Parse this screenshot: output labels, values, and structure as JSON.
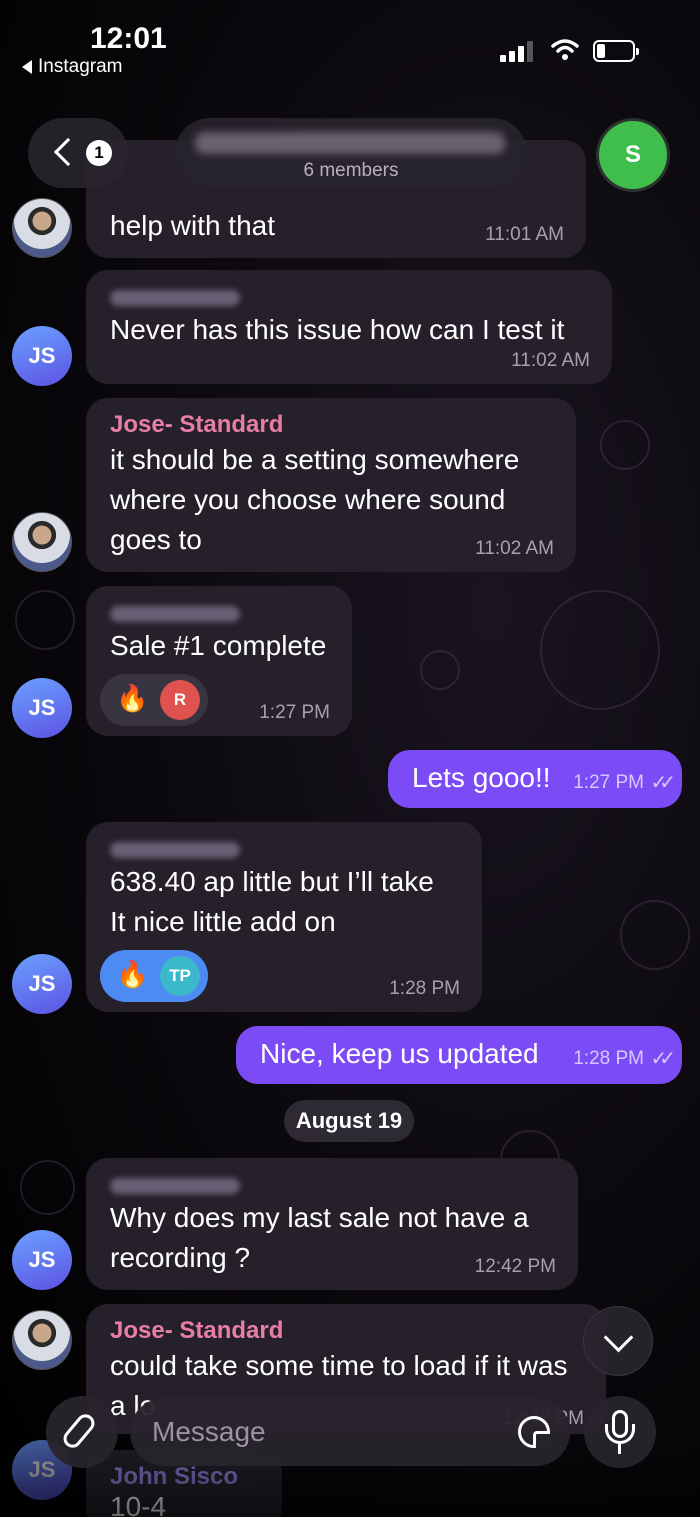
{
  "status_bar": {
    "time": "12:01",
    "back_app": "Instagram"
  },
  "header": {
    "unread_count": "1",
    "members": "6 members",
    "avatar_letter": "S",
    "avatar_color": "#3fbe4c"
  },
  "messages": [
    {
      "text": "help with that",
      "time": "11:01 AM"
    },
    {
      "text": "Never has this issue how can I test it",
      "time": "11:02 AM",
      "avatar": "JS"
    },
    {
      "sender": "Jose- Standard",
      "text": "it should be a setting somewhere\nwhere you choose where sound\ngoes to",
      "time": "11:02 AM"
    },
    {
      "text": "Sale #1 complete",
      "time": "1:27 PM",
      "avatar": "JS",
      "reaction_emoji": "🔥",
      "reaction_user": "R"
    },
    {
      "text": "Lets gooo!!",
      "time": "1:27 PM",
      "outgoing": true
    },
    {
      "text": "638.40 ap little but I’ll take\nIt nice little add on",
      "time": "1:28 PM",
      "avatar": "JS",
      "reaction_emoji": "🔥",
      "reaction_user": "TP"
    },
    {
      "text": "Nice, keep us updated",
      "time": "1:28 PM",
      "outgoing": true
    },
    {
      "text": "Why does my last sale not have a\nrecording ?",
      "time": "12:42 PM",
      "avatar": "JS"
    },
    {
      "sender": "Jose- Standard",
      "text": "could take some time to load if it was\na lo",
      "time": "12:47 PM"
    },
    {
      "sender": "John Sisco",
      "text": "10-4",
      "avatar": "JS"
    }
  ],
  "date_divider": "August 19",
  "input": {
    "placeholder": "Message"
  },
  "colors": {
    "outgoing_bubble": "#7b4cf5",
    "sender_name": "#e87ea8",
    "avatar_js": "#5d52e3",
    "reaction_r": "#e0524f",
    "reaction_tp": "#3bb8c9"
  },
  "icons": [
    "back-chevron-icon",
    "paperclip-icon",
    "sticker-icon",
    "microphone-icon",
    "chevron-down-icon",
    "signal-icon",
    "wifi-icon",
    "battery-icon"
  ]
}
